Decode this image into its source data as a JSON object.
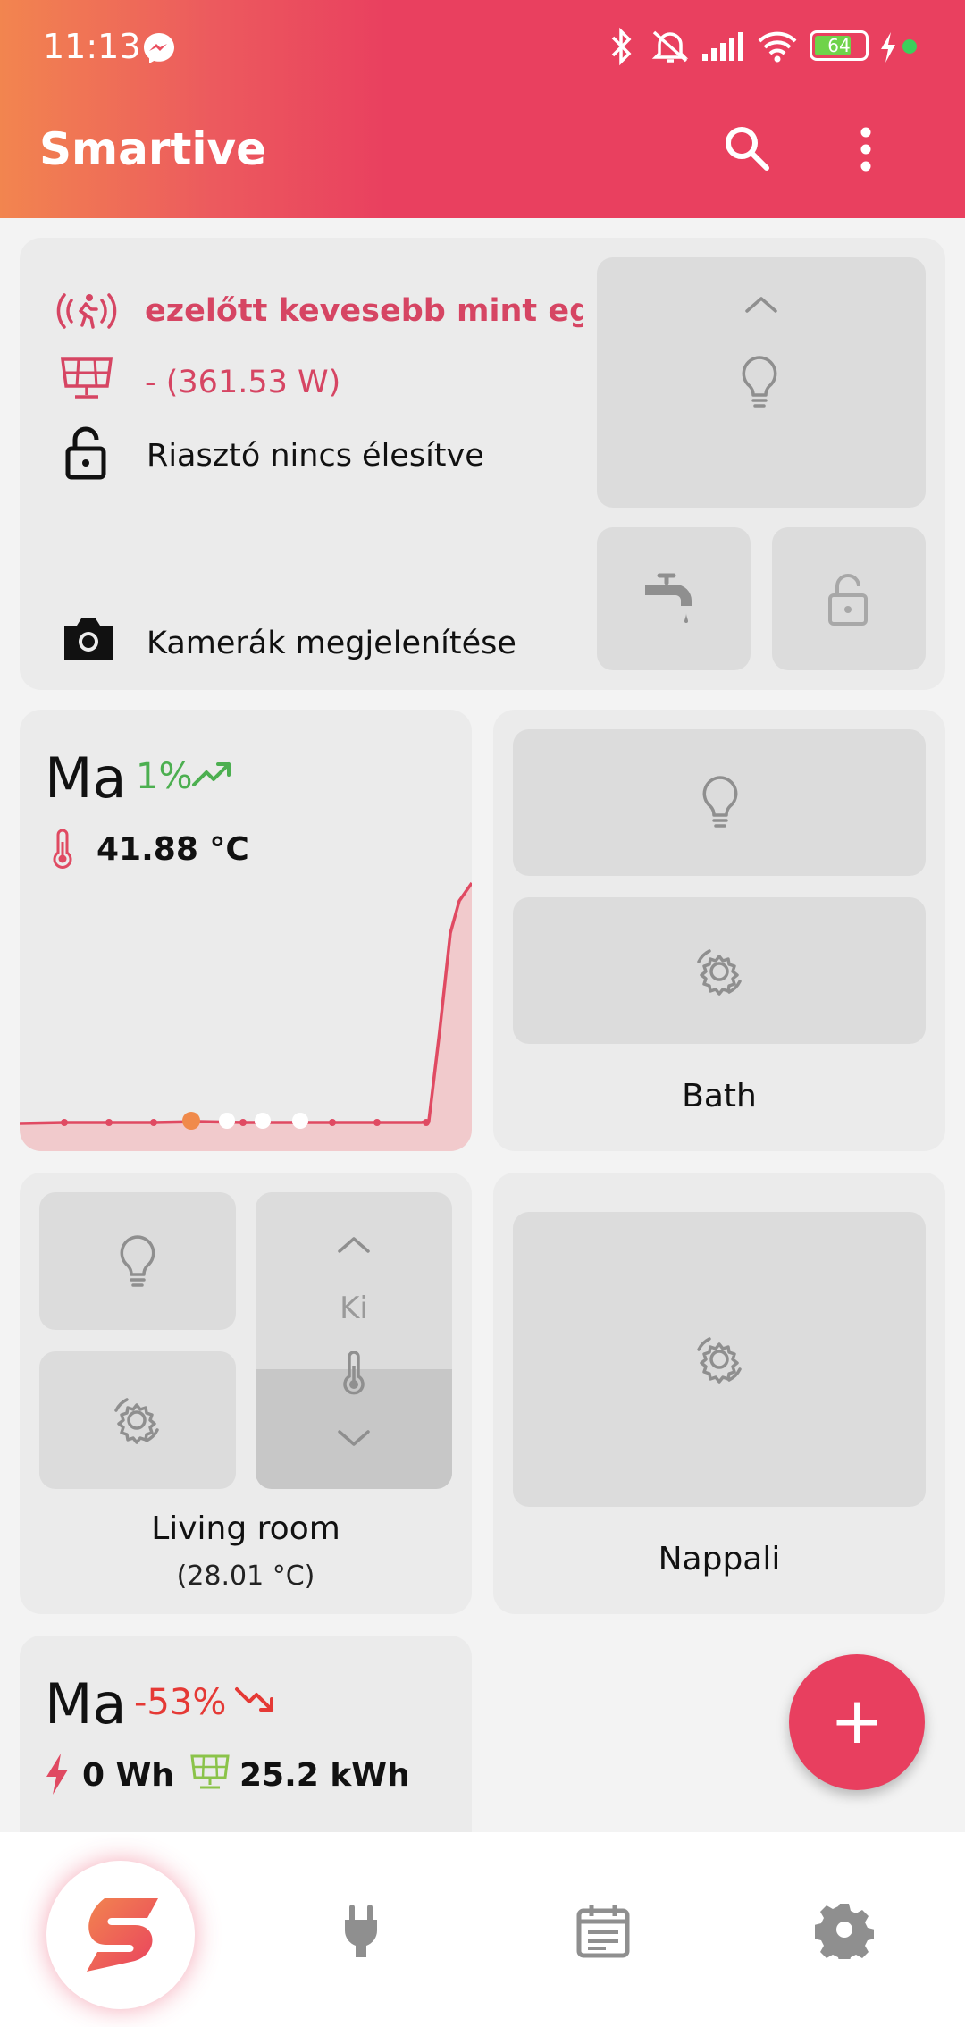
{
  "status_bar": {
    "time": "11:13",
    "battery": "64",
    "icons": [
      "messenger-icon",
      "bluetooth-icon",
      "mute-icon",
      "signal-icon",
      "wifi-icon",
      "battery-icon",
      "charging-icon"
    ]
  },
  "app_bar": {
    "title": "Smartive",
    "icons": [
      "search-icon",
      "more-vert-icon"
    ]
  },
  "summary_card": {
    "motion_text": "ezelőtt kevesebb mint egy...",
    "solar_text": "- (361.53 W)",
    "alarm_text": "Riasztó nincs élesítve",
    "camera_text": "Kamerák megjelenítése"
  },
  "temperature_card": {
    "period": "Ma",
    "change": "1%",
    "temperature": "41.88 °C"
  },
  "rooms": [
    {
      "name": "Bath"
    },
    {
      "name": "Living room",
      "temperature": "(28.01 °C)",
      "thermostat_state": "Ki"
    },
    {
      "name": "Nappali"
    }
  ],
  "energy_card": {
    "period": "Ma",
    "change": "-53%",
    "consumption": "0 Wh",
    "solar": "25.2 kWh"
  },
  "fab": {
    "label": "+"
  },
  "bottom_nav": {
    "items": [
      "smartive-logo",
      "plug-icon",
      "calendar-icon",
      "settings-icon"
    ]
  },
  "colors": {
    "accent": "#e9405f",
    "gradient_start": "#f2854f",
    "positive": "#4caf50",
    "negative": "#e53935",
    "solar_green": "#8bc34a"
  }
}
